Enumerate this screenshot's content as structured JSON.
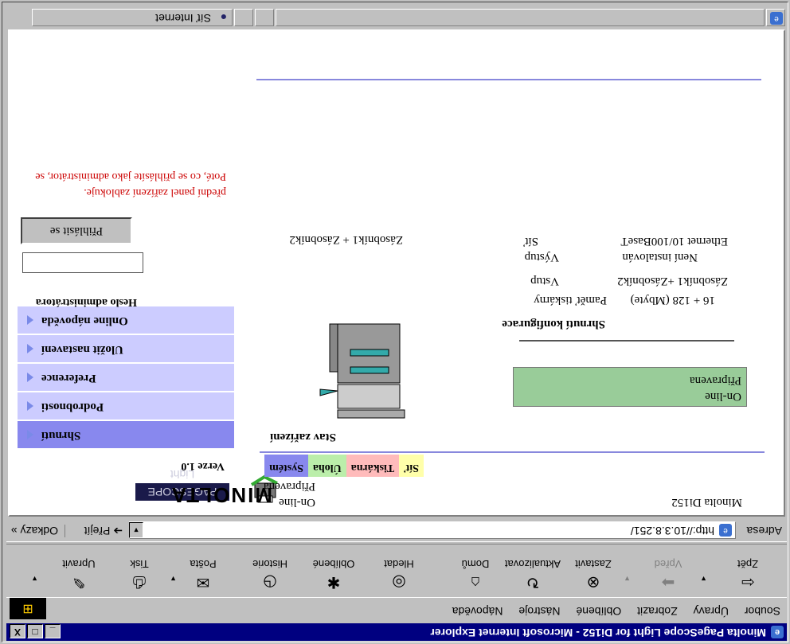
{
  "window": {
    "title": "Minolta PageScope Light for Di152 - Microsoft Internet Explorer",
    "minimize": "_",
    "maximize": "□",
    "close": "X"
  },
  "menu": [
    "Soubor",
    "Úpravy",
    "Zobrazit",
    "Oblíbené",
    "Nástroje",
    "Nápověda"
  ],
  "toolbar": [
    {
      "label": "Zpět",
      "icon": "back-arrow-icon",
      "glyph": "⇦",
      "disabled": false
    },
    {
      "label": "Vpřed",
      "icon": "forward-arrow-icon",
      "glyph": "➡",
      "disabled": true
    },
    {
      "label": "Zastavit",
      "icon": "stop-icon",
      "glyph": "⊗",
      "disabled": false
    },
    {
      "label": "Aktualizovat",
      "icon": "refresh-icon",
      "glyph": "↻",
      "disabled": false
    },
    {
      "label": "Domů",
      "icon": "home-icon",
      "glyph": "⌂",
      "disabled": false
    },
    {
      "label": "Hledat",
      "icon": "search-icon",
      "glyph": "◎",
      "disabled": false
    },
    {
      "label": "Oblíbené",
      "icon": "favorites-icon",
      "glyph": "✱",
      "disabled": false
    },
    {
      "label": "Historie",
      "icon": "history-icon",
      "glyph": "◷",
      "disabled": false
    },
    {
      "label": "Pošta",
      "icon": "mail-icon",
      "glyph": "✉",
      "disabled": false
    },
    {
      "label": "Tisk",
      "icon": "print-icon",
      "glyph": "⎙",
      "disabled": false
    },
    {
      "label": "Upravit",
      "icon": "edit-icon",
      "glyph": "✎",
      "disabled": false
    }
  ],
  "address": {
    "label": "Adresa",
    "url": "http://10.3.8.251/",
    "go_label": "Přejít",
    "links_label": "Odkazy"
  },
  "status": {
    "zone": "Síť Internet"
  },
  "page": {
    "model": "Minolta Di152",
    "brand": "MINOLTA",
    "product_logo": "PAGESCOPE Light",
    "online_small": "On-line",
    "ready_small": "Připravena",
    "version": "Verze 1.0",
    "tabs": [
      {
        "label": "Systém",
        "color": "#8888ee"
      },
      {
        "label": "Úloha",
        "color": "#bbeeaa"
      },
      {
        "label": "Tiskárna",
        "color": "#ffbbbb"
      },
      {
        "label": "Síť",
        "color": "#ffffaa"
      }
    ],
    "sidebar": [
      {
        "label": "Shrnutí",
        "active": true
      },
      {
        "label": "Podrobnosti",
        "active": false
      },
      {
        "label": "Preference",
        "active": false
      },
      {
        "label": "Uložit nastavení",
        "active": false
      },
      {
        "label": "Online nápověda",
        "active": false
      }
    ],
    "device_status_title": "Stav zařízení",
    "status_box": {
      "line1": "On-line",
      "line2": "Připravena"
    },
    "config_title": "Shrnutí konfigurace",
    "config": [
      {
        "key": "Paměť tiskárny",
        "value": "16 + 128 (Mbyte)"
      },
      {
        "key": "Vstup",
        "value": "Zásobník1 +Zásobník2"
      },
      {
        "key": "Výstup",
        "value": "Není instalován"
      },
      {
        "key": "Síť",
        "value": "Ethernet 10/100BaseT"
      }
    ],
    "slots_label": "Zásobník1 + Zásobník2",
    "admin_password_label": "Heslo administrátora",
    "login_button": "Přihlásit se",
    "warning_line1": "Poté, co se přihlásíte jako administrátor, se",
    "warning_line2": "přední panel zařízení zablokuje."
  }
}
